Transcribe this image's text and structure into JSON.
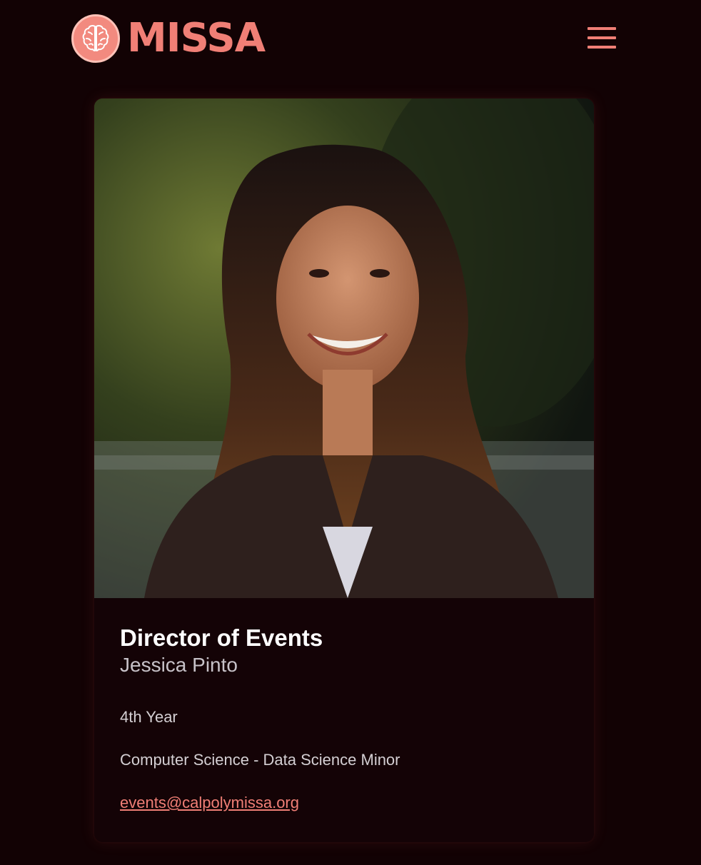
{
  "header": {
    "brand": "MISSA",
    "logo_icon": "brain-icon",
    "menu_icon": "hamburger-menu-icon"
  },
  "profile": {
    "photo_description_icon": "profile-photo",
    "role": "Director of Events",
    "name": "Jessica Pinto",
    "year": "4th Year",
    "major": "Computer Science - Data Science Minor",
    "email": "events@calpolymissa.org"
  },
  "colors": {
    "accent": "#f07f76",
    "background": "#120204",
    "card": "#140306",
    "text_primary": "#ffffff",
    "text_secondary": "#c7c2c8"
  }
}
